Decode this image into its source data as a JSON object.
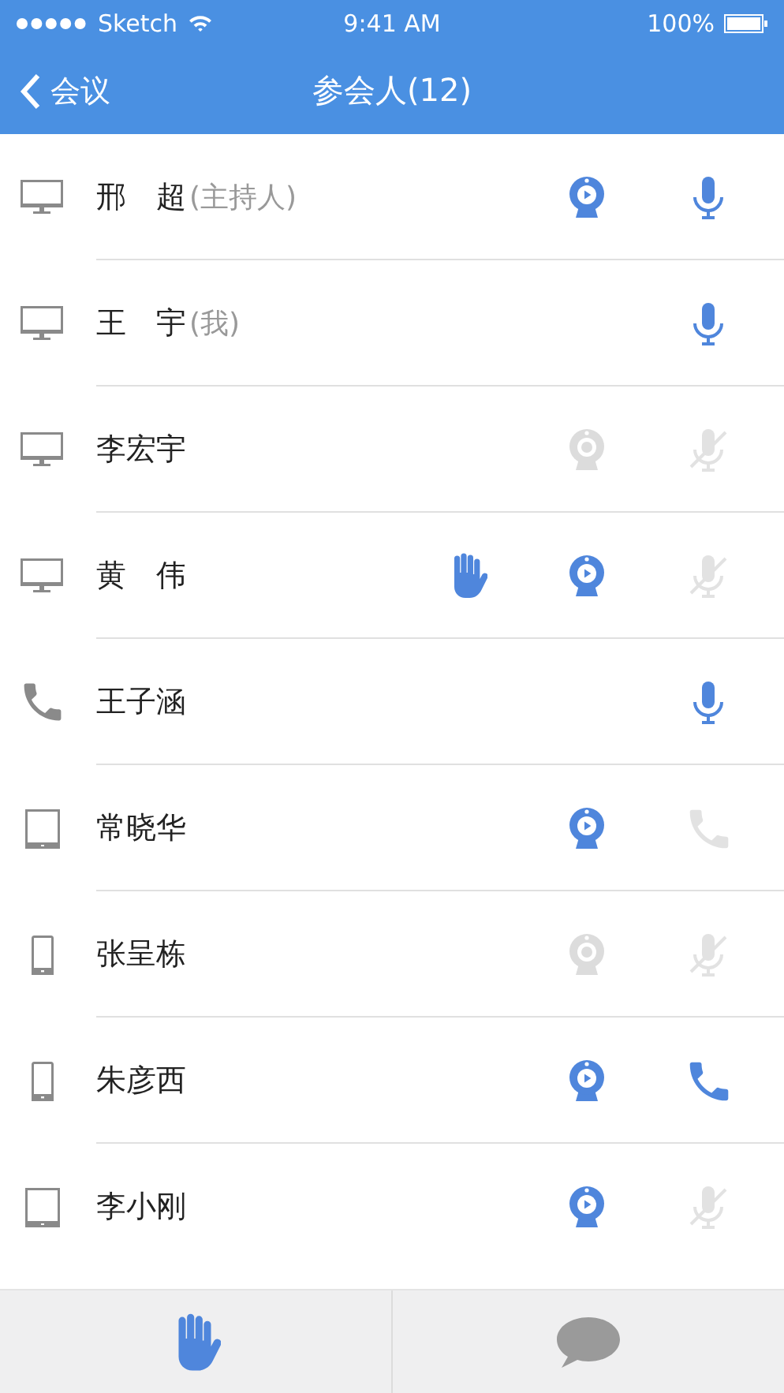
{
  "status_bar": {
    "carrier": "Sketch",
    "time": "9:41 AM",
    "battery": "100%"
  },
  "nav_bar": {
    "back_label": "会议",
    "title": "参会人(12)"
  },
  "participants": [
    {
      "kind": "desktop",
      "name": "邢　超",
      "note": "(主持人)",
      "hand_raised": false,
      "camera": {
        "on": true
      },
      "audio": {
        "kind": "mic",
        "on": true
      }
    },
    {
      "kind": "desktop",
      "name": "王　宇",
      "note": "(我)",
      "hand_raised": false,
      "audio": {
        "kind": "mic",
        "on": true
      }
    },
    {
      "kind": "desktop",
      "name": "李宏宇",
      "hand_raised": false,
      "camera": {
        "on": false
      },
      "audio": {
        "kind": "mic",
        "on": false
      }
    },
    {
      "kind": "desktop",
      "name": "黄　伟",
      "hand_raised": true,
      "camera": {
        "on": true
      },
      "audio": {
        "kind": "mic",
        "on": false
      }
    },
    {
      "kind": "phone",
      "name": "王子涵",
      "hand_raised": false,
      "audio": {
        "kind": "mic",
        "on": true
      }
    },
    {
      "kind": "tablet",
      "name": "常晓华",
      "hand_raised": false,
      "camera": {
        "on": true
      },
      "audio": {
        "kind": "phone",
        "on": false
      }
    },
    {
      "kind": "mobile",
      "name": "张呈栋",
      "hand_raised": false,
      "camera": {
        "on": false
      },
      "audio": {
        "kind": "mic",
        "on": false
      }
    },
    {
      "kind": "mobile",
      "name": "朱彦西",
      "hand_raised": false,
      "camera": {
        "on": true
      },
      "audio": {
        "kind": "phone",
        "on": true
      }
    },
    {
      "kind": "tablet",
      "name": "李小刚",
      "hand_raised": false,
      "camera": {
        "on": true
      },
      "audio": {
        "kind": "mic",
        "on": false
      }
    }
  ],
  "toolbar": [
    {
      "kind": "raise-hand"
    },
    {
      "kind": "chat"
    }
  ]
}
